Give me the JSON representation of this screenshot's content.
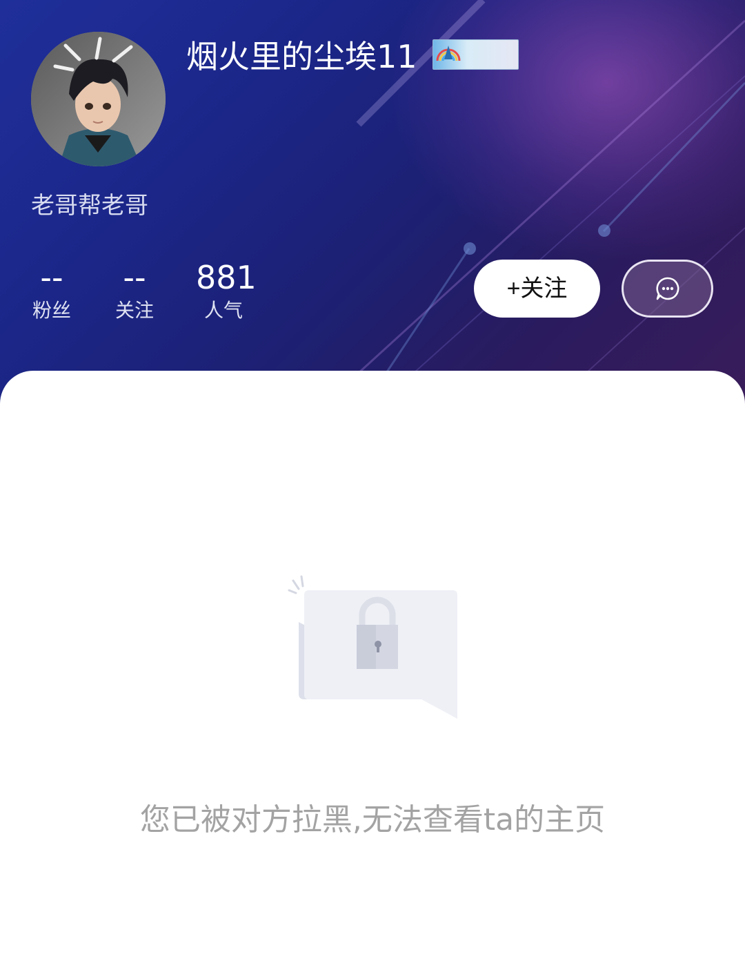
{
  "profile": {
    "username": "烟火里的尘埃11",
    "badge_icon": "rainbow-medal-badge",
    "signature": "老哥帮老哥"
  },
  "stats": [
    {
      "value": "--",
      "label": "粉丝"
    },
    {
      "value": "--",
      "label": "关注"
    },
    {
      "value": "881",
      "label": "人气"
    }
  ],
  "actions": {
    "follow_label": "+关注",
    "message_icon": "chat-bubble-icon"
  },
  "empty_state": {
    "icon": "locked-page-icon",
    "message": "您已被对方拉黑,无法查看ta的主页"
  },
  "colors": {
    "header_primary": "#1d2478",
    "header_accent": "#3a1c5a",
    "muted_text": "#a3a3a3"
  }
}
